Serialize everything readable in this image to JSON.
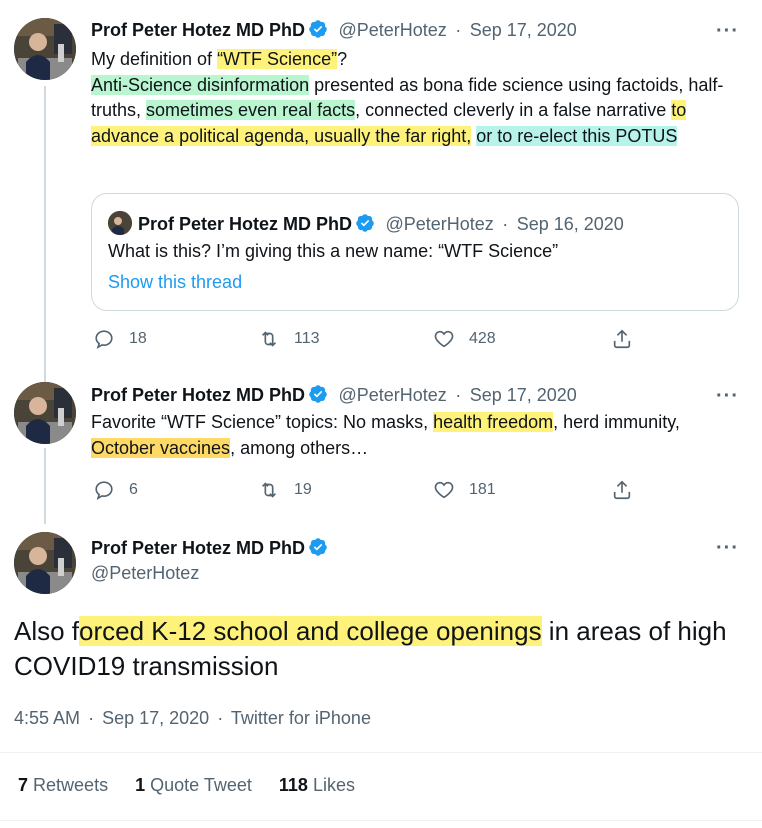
{
  "tweet1": {
    "author_name": "Prof Peter Hotez MD PhD",
    "handle": "@PeterHotez",
    "dot": "·",
    "date": "Sep 17, 2020",
    "more": "···",
    "text": {
      "t1": "My definition of ",
      "h1": "“WTF Science”",
      "t2": "?",
      "h2": "Anti-Science disinformation",
      "t3": " presented as bona fide science using factoids, half-truths, ",
      "h3": "sometimes even real facts",
      "t4": ", connected cleverly in a false narrative ",
      "h4": "to advance a political agenda, usually the far right,",
      "t5": " ",
      "h5": "or to re-elect this POTUS"
    },
    "quote": {
      "author_name": "Prof Peter Hotez MD PhD",
      "handle": "@PeterHotez",
      "dot": "·",
      "date": "Sep 16, 2020",
      "text": "What is this? I’m giving this a new name: “WTF Science”",
      "link": "Show this thread"
    },
    "replies": "18",
    "retweets": "113",
    "likes": "428"
  },
  "tweet2": {
    "author_name": "Prof Peter Hotez MD PhD",
    "handle": "@PeterHotez",
    "dot": "·",
    "date": "Sep 17, 2020",
    "more": "···",
    "text": {
      "t1": "Favorite “WTF Science” topics: No masks, ",
      "h1": "health freedom",
      "t2": ", herd immunity, ",
      "h2": "October vaccines",
      "t3": ", among others…"
    },
    "replies": "6",
    "retweets": "19",
    "likes": "181"
  },
  "main": {
    "author_name": "Prof Peter Hotez MD PhD",
    "handle": "@PeterHotez",
    "more": "···",
    "text": {
      "t1": "Also f",
      "h1": "orced K-12 school and college openings",
      "t2": " in areas of high COVID19 transmission"
    },
    "time": "4:55 AM",
    "dot1": "·",
    "date": "Sep 17, 2020",
    "dot2": "·",
    "source": "Twitter for iPhone",
    "stats": {
      "retweets_count": "7",
      "retweets_label": "Retweets",
      "quotes_count": "1",
      "quotes_label": "Quote Tweet",
      "likes_count": "118",
      "likes_label": "Likes"
    }
  },
  "colors": {
    "highlight_yellow": "#fff27a",
    "highlight_green": "#b9f5cf",
    "highlight_cyan": "#b8f3ea",
    "highlight_orange": "#ffd966",
    "link_blue": "#1d9bf0",
    "muted": "#536471"
  }
}
